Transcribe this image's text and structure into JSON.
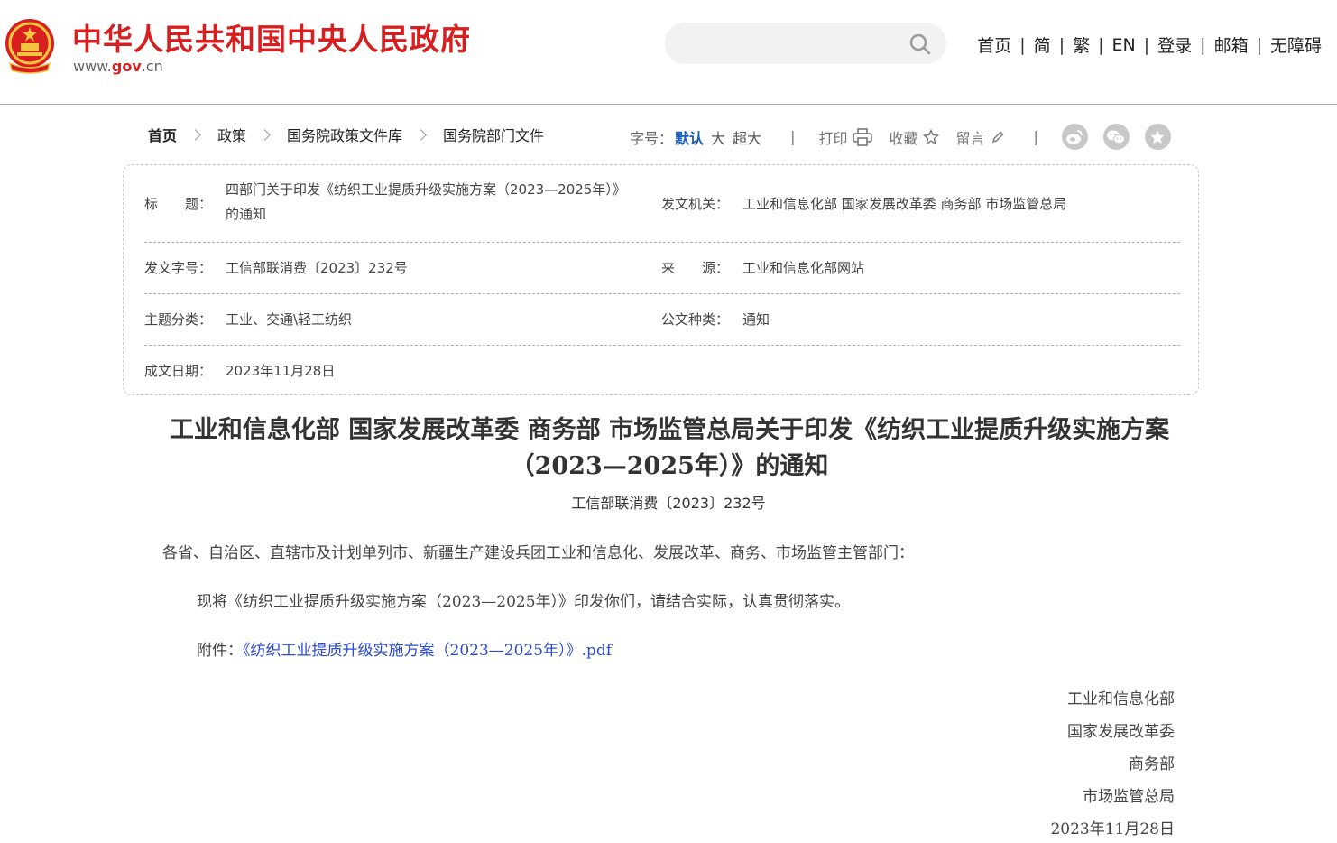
{
  "header": {
    "site_title": "中华人民共和国中央人民政府",
    "site_url_prefix": "www.",
    "site_url_mid": "gov",
    "site_url_suffix": ".cn",
    "search_placeholder": "",
    "nav": [
      "首页",
      "简",
      "繁",
      "EN",
      "登录",
      "邮箱",
      "无障碍"
    ]
  },
  "breadcrumb": [
    "首页",
    "政策",
    "国务院政策文件库",
    "国务院部门文件"
  ],
  "tools": {
    "font_label": "字号：",
    "font_default": "默认",
    "font_large": "大",
    "font_xlarge": "超大",
    "print": "打印",
    "favorite": "收藏",
    "comment": "留言",
    "share_icons": [
      "weibo-icon",
      "wechat-icon",
      "favorite-star-icon"
    ]
  },
  "meta": {
    "title_label": "标　　题：",
    "title_value": "四部门关于印发《纺织工业提质升级实施方案（2023—2025年）》的通知",
    "issuer_label": "发文机关：",
    "issuer_value": "工业和信息化部  国家发展改革委  商务部  市场监管总局",
    "docno_label": "发文字号：",
    "docno_value": "工信部联消费〔2023〕232号",
    "source_label": "来　　源：",
    "source_value": "工业和信息化部网站",
    "topic_label": "主题分类：",
    "topic_value": "工业、交通\\轻工纺织",
    "type_label": "公文种类：",
    "type_value": "通知",
    "date_label": "成文日期：",
    "date_value": "2023年11月28日"
  },
  "article": {
    "title": "工业和信息化部  国家发展改革委  商务部  市场监管总局关于印发《纺织工业提质升级实施方案（2023—2025年）》的通知",
    "doc_number": "工信部联消费〔2023〕232号",
    "salutation": "各省、自治区、直辖市及计划单列市、新疆生产建设兵团工业和信息化、发展改革、商务、市场监管主管部门：",
    "body": "现将《纺织工业提质升级实施方案（2023—2025年）》印发你们，请结合实际，认真贯彻落实。",
    "attachment_label": "附件：",
    "attachment_link": "《纺织工业提质升级实施方案（2023—2025年）》.pdf",
    "signatories": [
      "工业和信息化部",
      "国家发展改革委",
      "商务部",
      "市场监管总局"
    ],
    "date": "2023年11月28日"
  },
  "colors": {
    "brand_red": "#d71f1f",
    "link_blue": "#2b4cd0",
    "active_font_blue": "#1a5bb8"
  }
}
